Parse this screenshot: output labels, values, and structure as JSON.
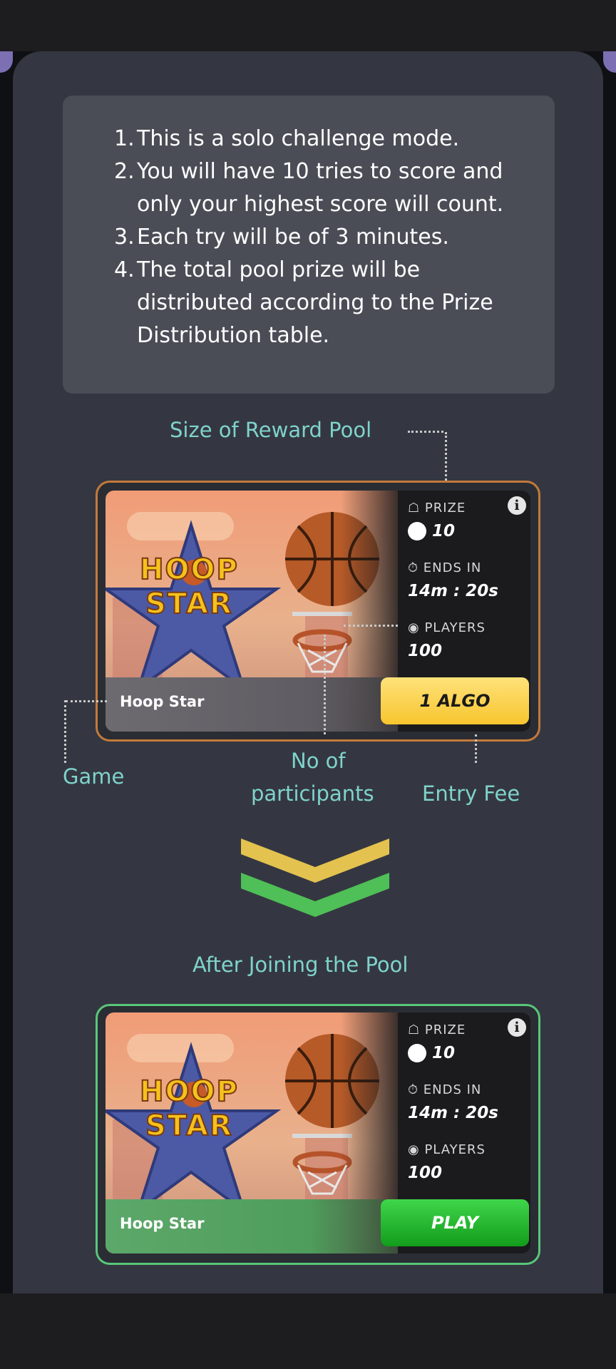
{
  "rules": [
    {
      "num": "1.",
      "text": "This is a solo challenge mode."
    },
    {
      "num": "2.",
      "text": "You will have 10 tries to score and only your highest score will count."
    },
    {
      "num": "3.",
      "text": "Each try will be of 3 minutes."
    },
    {
      "num": "4.",
      "text": "The total pool prize will be distributed according to the Prize Distribution table."
    }
  ],
  "annotations": {
    "reward_pool": "Size of Reward Pool",
    "game": "Game",
    "participants_line1": "No of",
    "participants_line2": "participants",
    "entry_fee": "Entry Fee",
    "after_joining": "After Joining the Pool"
  },
  "card_before": {
    "game_name": "Hoop Star",
    "logo_line1": "HOOP",
    "logo_line2": "STAR",
    "prize_label": "PRIZE",
    "prize_value": "10",
    "ends_label": "ENDS IN",
    "ends_value": "14m : 20s",
    "players_label": "PLAYERS",
    "players_value": "100",
    "button_label": "1 ALGO",
    "info_glyph": "i"
  },
  "card_after": {
    "game_name": "Hoop Star",
    "logo_line1": "HOOP",
    "logo_line2": "STAR",
    "prize_label": "PRIZE",
    "prize_value": "10",
    "ends_label": "ENDS IN",
    "ends_value": "14m : 20s",
    "players_label": "PLAYERS",
    "players_value": "100",
    "button_label": "PLAY",
    "info_glyph": "i"
  },
  "colors": {
    "accent_teal": "#7fd3cc",
    "entry_button": "#f7c52e",
    "play_button": "#139c1c",
    "frame_before": "#c27a3b",
    "frame_after": "#58c77a"
  }
}
